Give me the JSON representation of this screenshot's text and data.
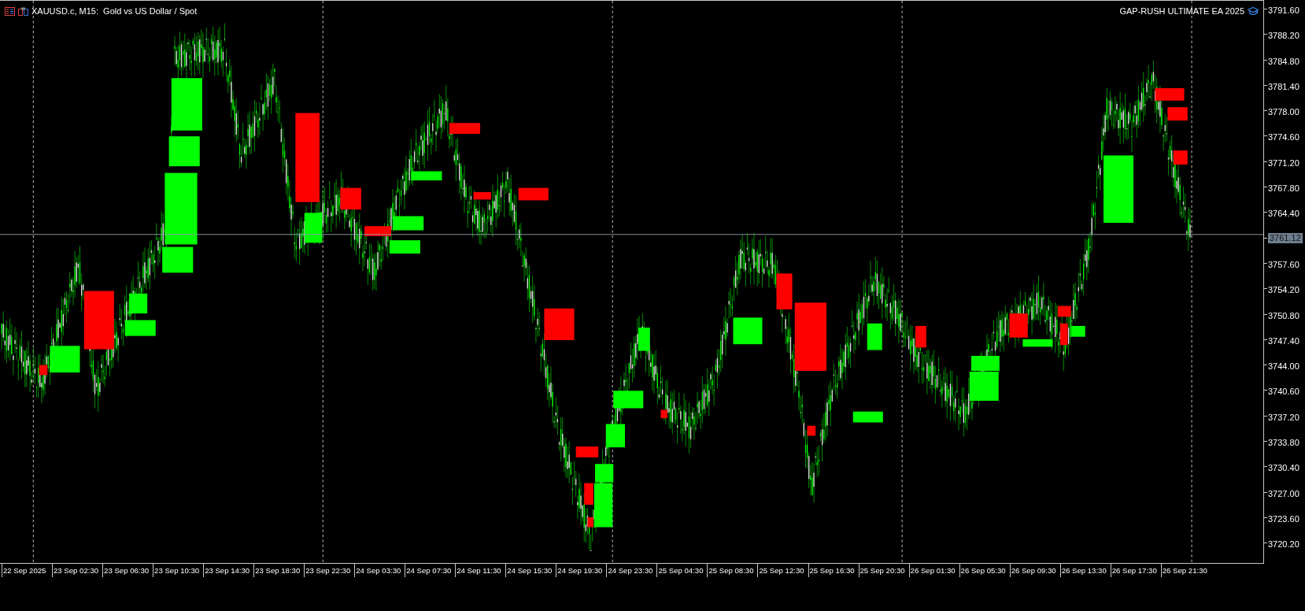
{
  "chart": {
    "symbol_title": "XAUUSD.c, M15:  Gold vs US Dollar / Spot",
    "ea_label": "GAP-RUSH ULTIMATE EA 2025",
    "current_price": "3761.12",
    "price_axis": [
      "3791.60",
      "3788.20",
      "3784.80",
      "3781.40",
      "3778.00",
      "3774.60",
      "3771.20",
      "3767.80",
      "3764.40",
      "3757.60",
      "3754.20",
      "3750.80",
      "3747.40",
      "3744.00",
      "3740.60",
      "3737.20",
      "3733.80",
      "3730.40",
      "3727.00",
      "3723.60",
      "3720.20"
    ],
    "time_axis": [
      "22 Sep 2025",
      "23 Sep 02:30",
      "23 Sep 06:30",
      "23 Sep 10:30",
      "23 Sep 14:30",
      "23 Sep 18:30",
      "23 Sep 22:30",
      "24 Sep 03:30",
      "24 Sep 07:30",
      "24 Sep 11:30",
      "24 Sep 15:30",
      "24 Sep 19:30",
      "24 Sep 23:30",
      "25 Sep 04:30",
      "25 Sep 08:30",
      "25 Sep 12:30",
      "25 Sep 16:30",
      "25 Sep 20:30",
      "26 Sep 01:30",
      "26 Sep 05:30",
      "26 Sep 09:30",
      "26 Sep 13:30",
      "26 Sep 17:30",
      "26 Sep 21:30"
    ]
  }
}
